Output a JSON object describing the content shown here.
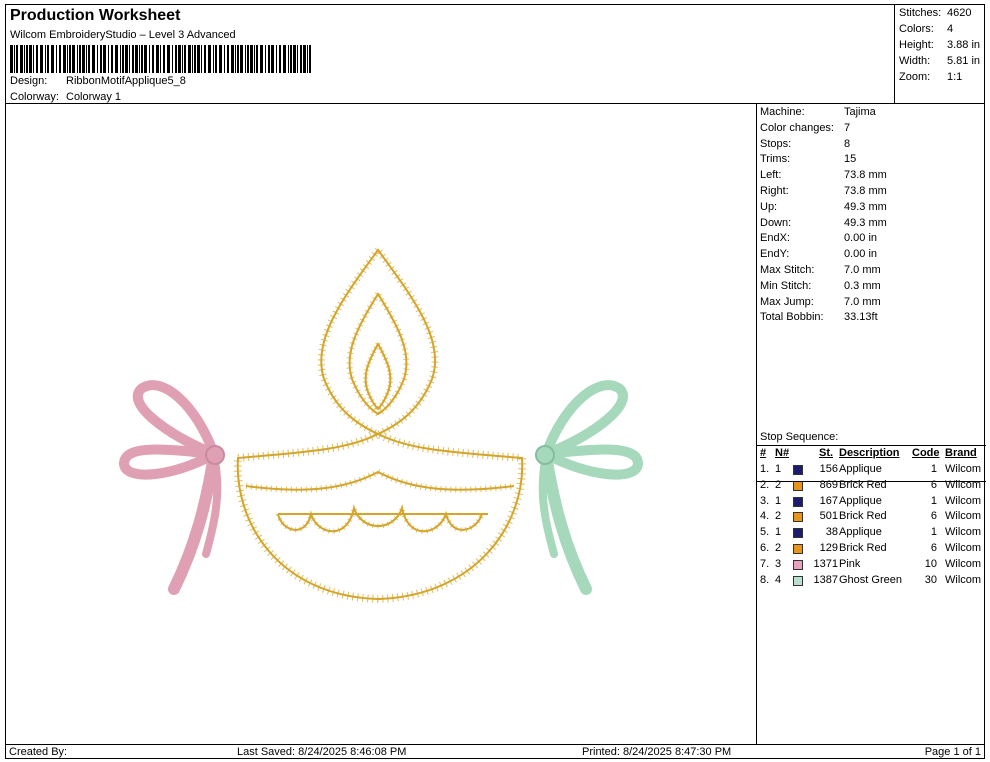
{
  "header": {
    "title": "Production Worksheet",
    "software": "Wilcom EmbroideryStudio – Level 3 Advanced",
    "design_label": "Design:",
    "design_value": "RibbonMotifApplique5_8",
    "colorway_label": "Colorway:",
    "colorway_value": "Colorway 1"
  },
  "stats": [
    {
      "k": "Stitches:",
      "v": "4620"
    },
    {
      "k": "Colors:",
      "v": "4"
    },
    {
      "k": "Height:",
      "v": "3.88 in"
    },
    {
      "k": "Width:",
      "v": "5.81 in"
    },
    {
      "k": "Zoom:",
      "v": "1:1"
    }
  ],
  "info": [
    {
      "k": "Machine:",
      "v": "Tajima"
    },
    {
      "k": "Color changes:",
      "v": "7"
    },
    {
      "k": "Stops:",
      "v": "8"
    },
    {
      "k": "Trims:",
      "v": "15"
    },
    {
      "k": "Left:",
      "v": "73.8 mm"
    },
    {
      "k": "Right:",
      "v": "73.8 mm"
    },
    {
      "k": "Up:",
      "v": "49.3 mm"
    },
    {
      "k": "Down:",
      "v": "49.3 mm"
    },
    {
      "k": "EndX:",
      "v": "0.00 in"
    },
    {
      "k": "EndY:",
      "v": "0.00 in"
    },
    {
      "k": "Max Stitch:",
      "v": "7.0 mm"
    },
    {
      "k": "Min Stitch:",
      "v": "0.3 mm"
    },
    {
      "k": "Max Jump:",
      "v": "7.0 mm"
    },
    {
      "k": "Total Bobbin:",
      "v": "33.13ft"
    }
  ],
  "stop_sequence": {
    "label": "Stop Sequence:",
    "headers": {
      "num": "#",
      "n": "N#",
      "st": "St.",
      "desc": "Description",
      "code": "Code",
      "brand": "Brand"
    },
    "rows": [
      {
        "num": "1.",
        "n": "1",
        "color": "#1c1c6e",
        "st": "156",
        "desc": "Applique",
        "code": "1",
        "brand": "Wilcom"
      },
      {
        "num": "2.",
        "n": "2",
        "color": "#e8941a",
        "st": "869",
        "desc": "Brick Red",
        "code": "6",
        "brand": "Wilcom"
      },
      {
        "num": "3.",
        "n": "1",
        "color": "#1c1c6e",
        "st": "167",
        "desc": "Applique",
        "code": "1",
        "brand": "Wilcom"
      },
      {
        "num": "4.",
        "n": "2",
        "color": "#e8941a",
        "st": "501",
        "desc": "Brick Red",
        "code": "6",
        "brand": "Wilcom"
      },
      {
        "num": "5.",
        "n": "1",
        "color": "#1c1c6e",
        "st": "38",
        "desc": "Applique",
        "code": "1",
        "brand": "Wilcom"
      },
      {
        "num": "6.",
        "n": "2",
        "color": "#e8941a",
        "st": "129",
        "desc": "Brick Red",
        "code": "6",
        "brand": "Wilcom"
      },
      {
        "num": "7.",
        "n": "3",
        "color": "#e8a0c0",
        "st": "1371",
        "desc": "Pink",
        "code": "10",
        "brand": "Wilcom"
      },
      {
        "num": "8.",
        "n": "4",
        "color": "#b8e0cc",
        "st": "1387",
        "desc": "Ghost Green",
        "code": "30",
        "brand": "Wilcom"
      }
    ]
  },
  "footer": {
    "created": "Created By:",
    "saved": "Last Saved: 8/24/2025 8:46:08 PM",
    "printed": "Printed: 8/24/2025 8:47:30 PM",
    "page": "Page 1 of 1"
  },
  "colors": {
    "gold": "#d4a52a",
    "pink": "#e0a0b4",
    "green": "#a6d8bc"
  }
}
